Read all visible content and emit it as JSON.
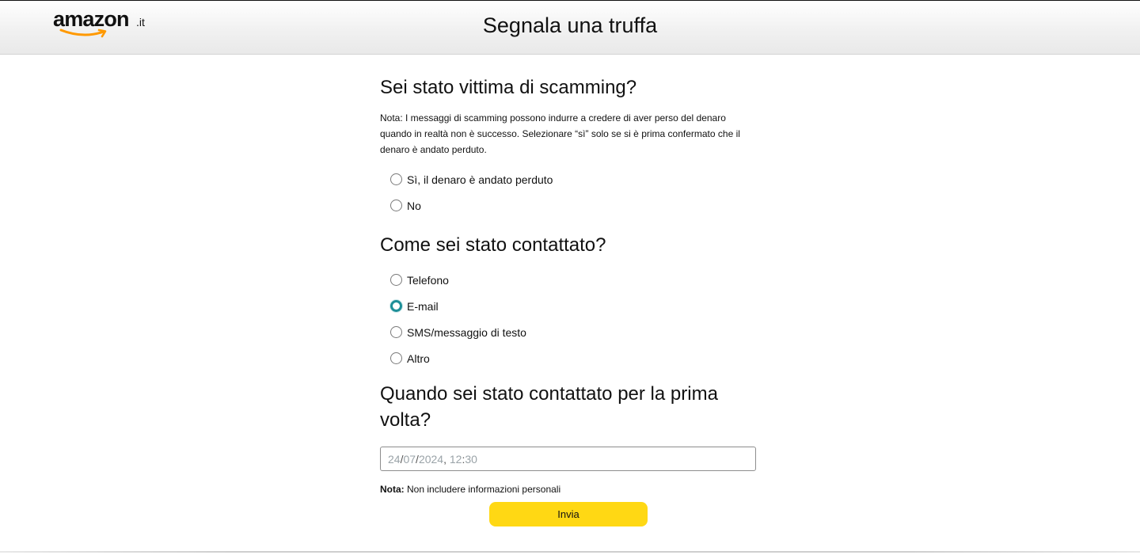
{
  "header": {
    "logo_word": "amazon",
    "logo_tld": ".it",
    "title": "Segnala una truffa"
  },
  "section_victim": {
    "heading": "Sei stato vittima di scamming?",
    "note": "Nota: I messaggi di scamming possono indurre a credere di aver perso del denaro quando in realtà non è successo. Selezionare “sì” solo se si è prima confermato che il denaro è andato perduto.",
    "options": [
      {
        "label": "Sì, il denaro è andato perduto",
        "selected": false
      },
      {
        "label": "No",
        "selected": false
      }
    ]
  },
  "section_contact": {
    "heading": "Come sei stato contattato?",
    "options": [
      {
        "label": "Telefono",
        "selected": false
      },
      {
        "label": "E-mail",
        "selected": false,
        "focused": true
      },
      {
        "label": "SMS/messaggio di testo",
        "selected": false
      },
      {
        "label": "Altro",
        "selected": false
      }
    ]
  },
  "section_date": {
    "heading": "Quando sei stato contattato per la prima volta?",
    "day": "24",
    "month": "07",
    "year": "2024",
    "hour": "12",
    "minute": "30"
  },
  "bottom_note": {
    "label": "Nota:",
    "text": "Non includere informazioni personali"
  },
  "submit_label": "Invia",
  "colors": {
    "button": "#ffd814",
    "focus_ring": "#1e8f98",
    "logo_smile": "#ff9900"
  }
}
